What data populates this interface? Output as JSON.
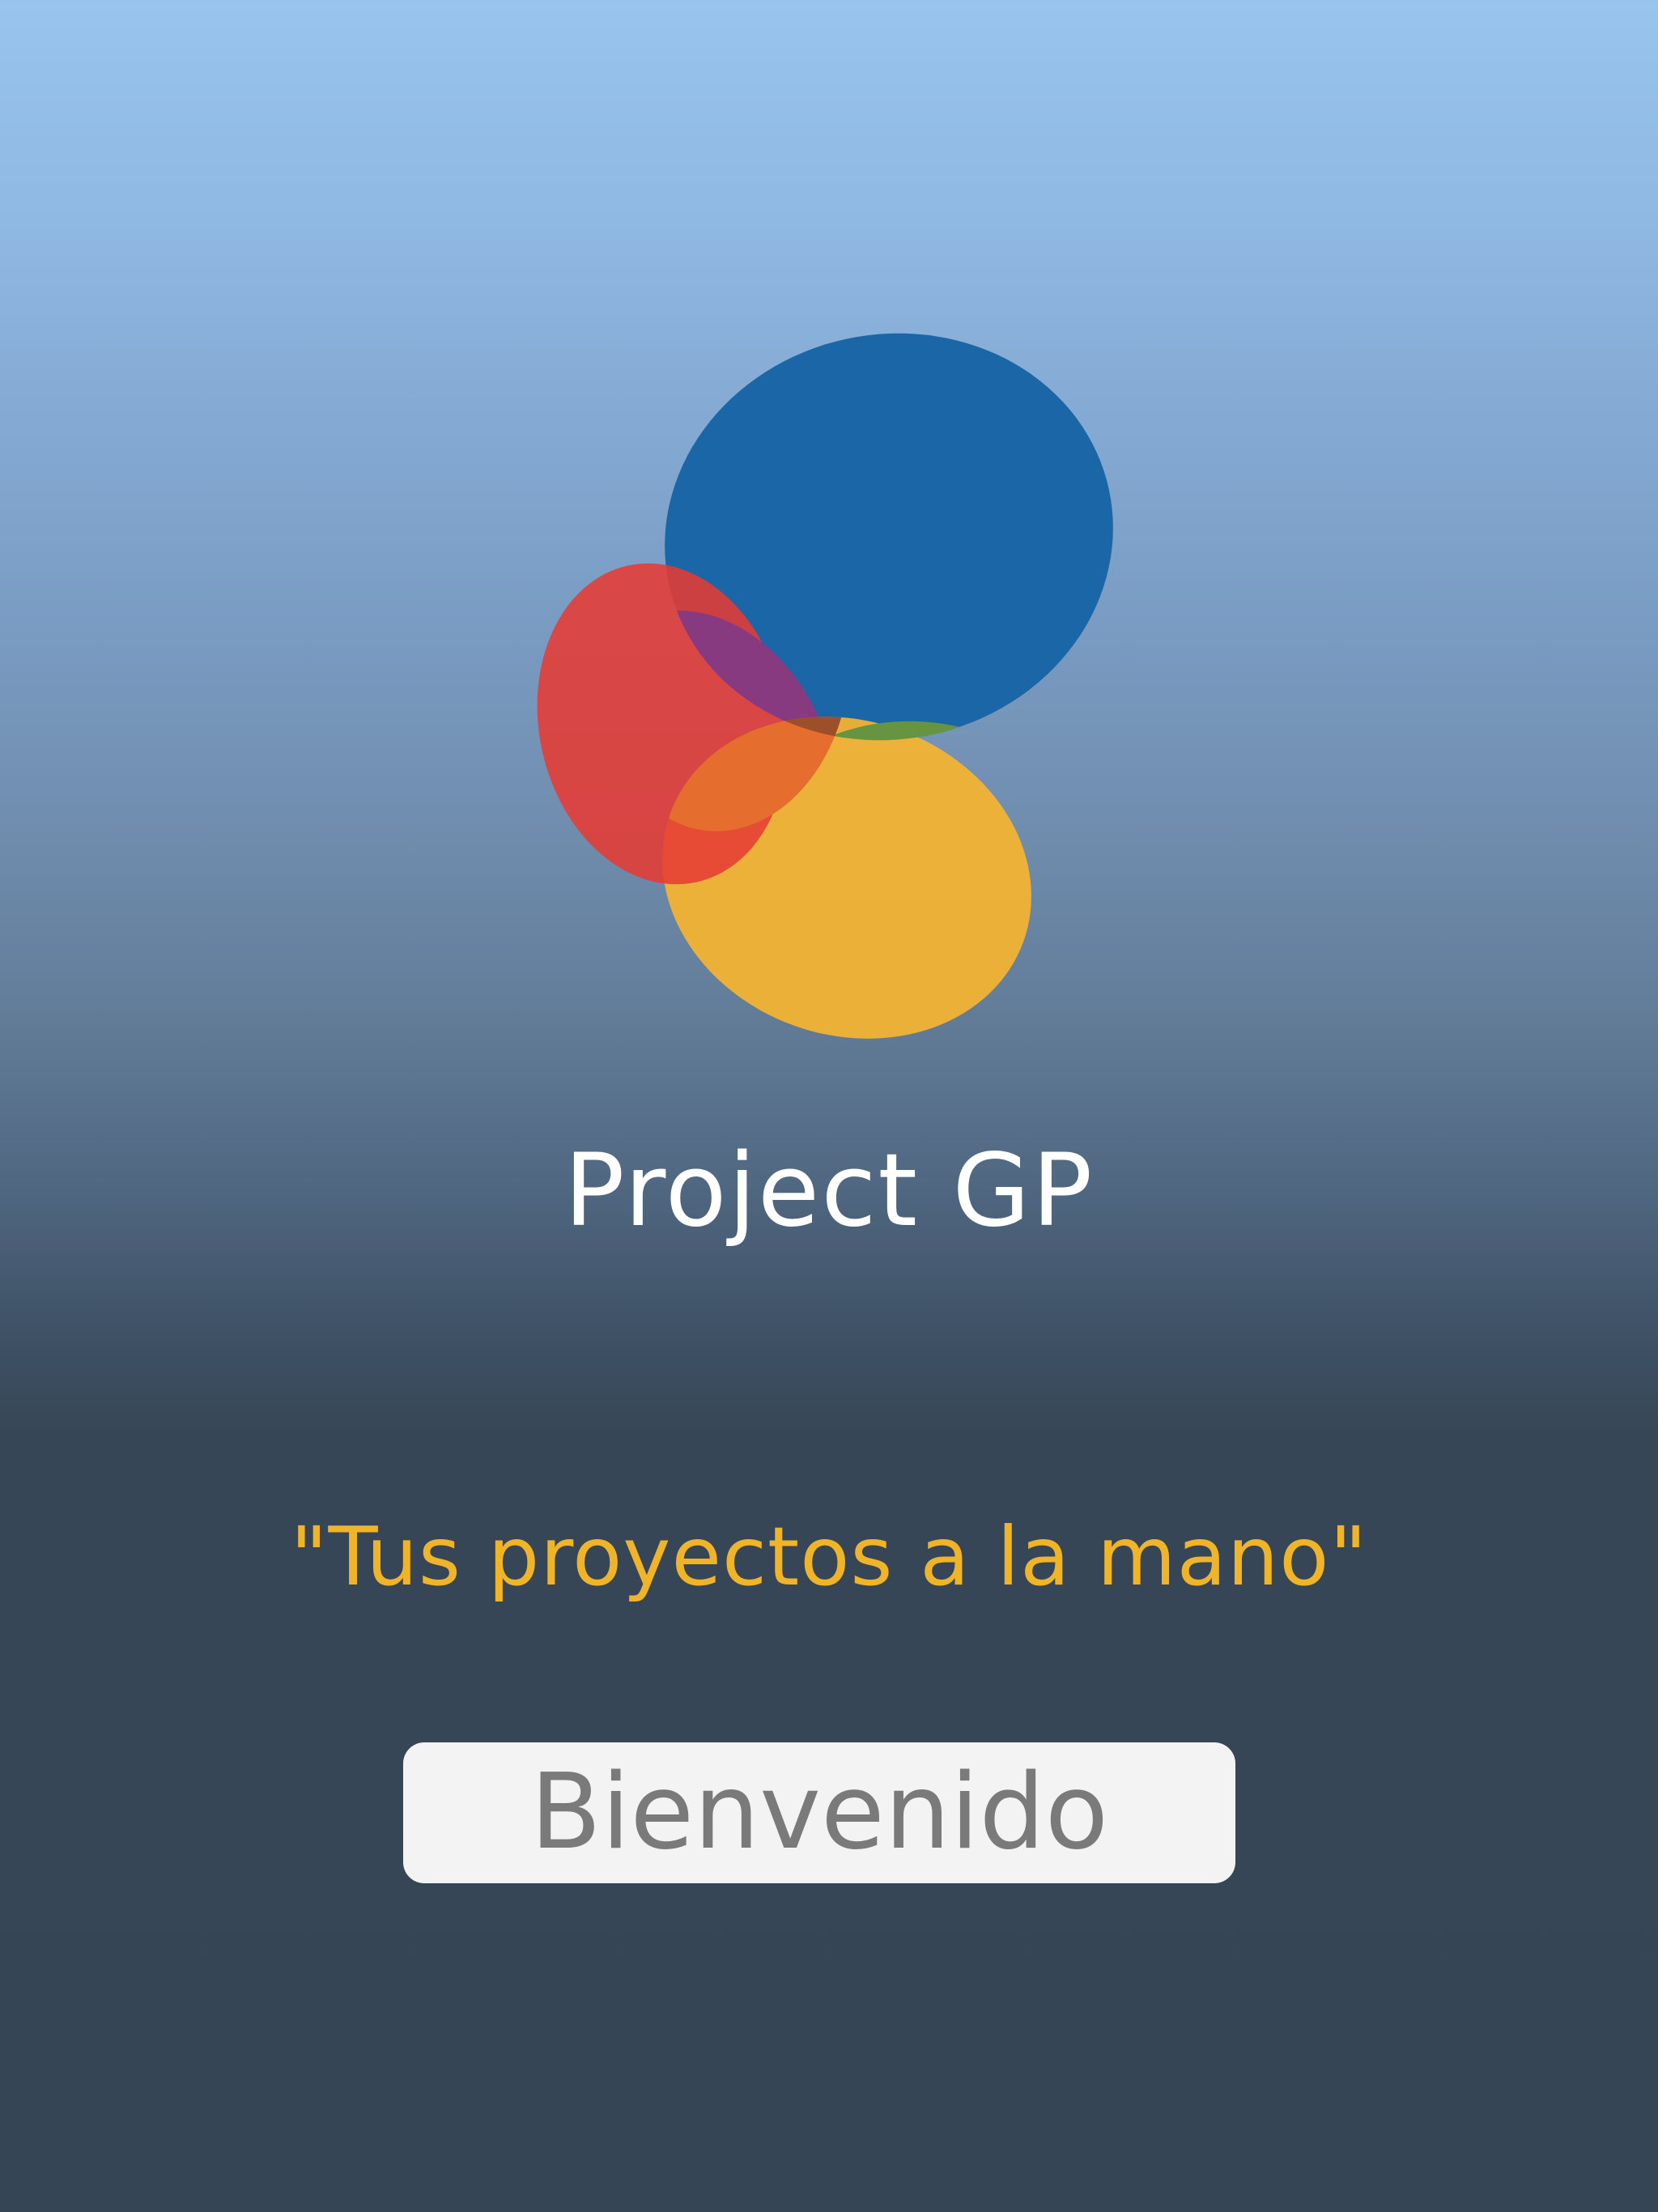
{
  "app": {
    "name": "Project GP",
    "tagline": "\"Tus proyectos a la mano\""
  },
  "welcome_button": {
    "label": "Bienvenido"
  },
  "colors": {
    "background_top": "#98c4ee",
    "background_bottom": "#354555",
    "brand_text": "#ffffff",
    "tagline_text": "#f0b428",
    "button_bg": "#f3f3f3",
    "button_text": "#7a7a7a",
    "logo_blue": "#1a66a6",
    "logo_red": "#e63b34",
    "logo_yellow": "#f6b42f"
  },
  "icons": {
    "logo": "overlapping-circles-logo"
  }
}
